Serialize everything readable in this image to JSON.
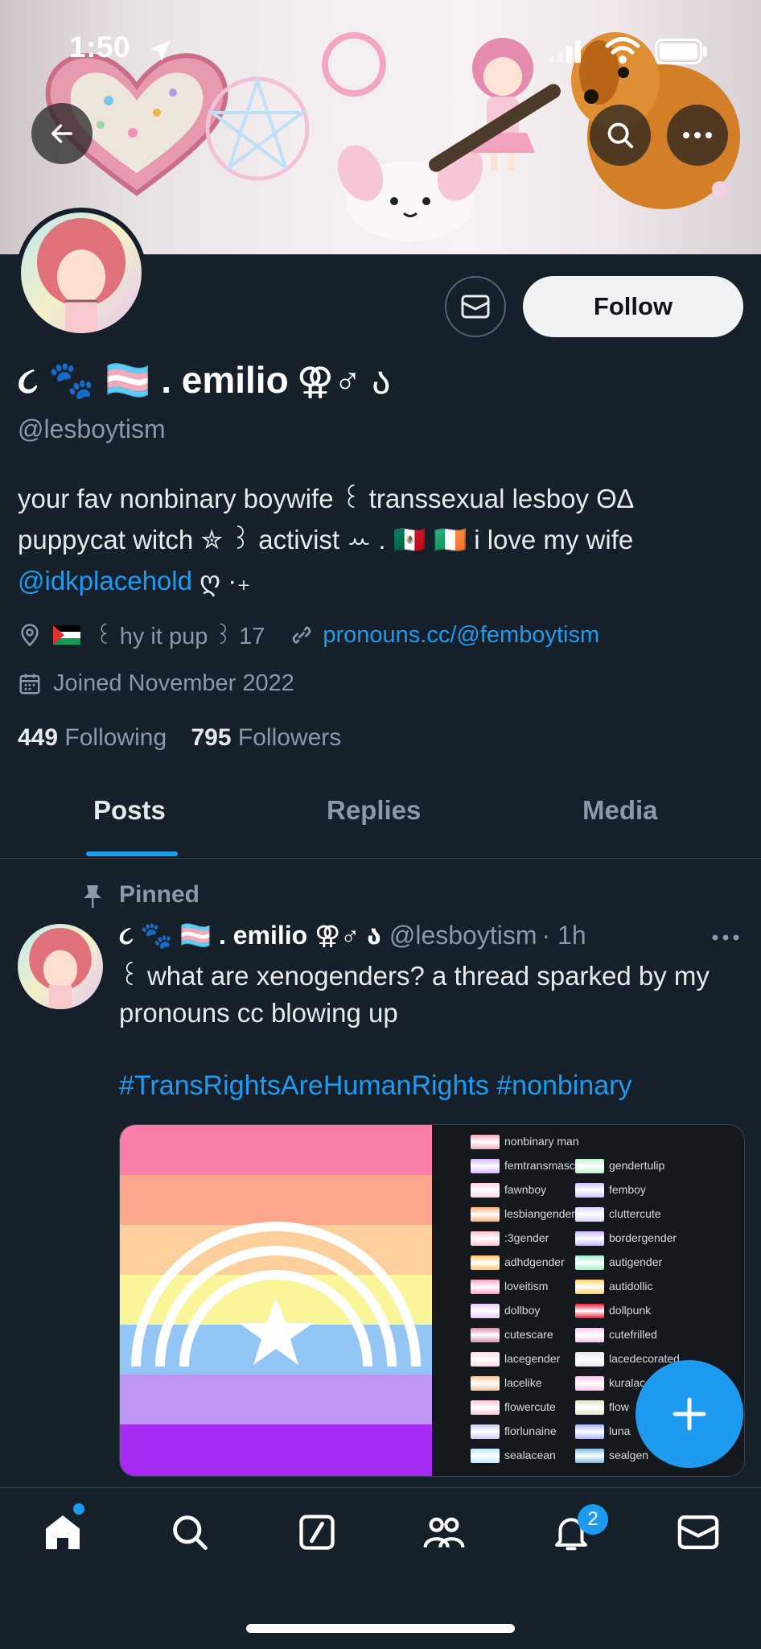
{
  "status_bar": {
    "time": "1:50"
  },
  "profile": {
    "display_name_prefix": "૮ 🐾 🏳️‍⚧️ . emilio",
    "display_name_suffix": "⚢♂ ა",
    "handle": "@lesboytism",
    "follow_label": "Follow",
    "bio_line1": "your fav nonbinary boywife ꒰ transsexual lesboy ΘΔ",
    "bio_line2": "puppycat witch ✮ ꒱ activist ꕀ . 🇲🇽 🇮🇪 i love my wife",
    "bio_mention": "@idkplacehold",
    "bio_tail": "ღ ·₊",
    "location": "꒰ hy it pup ꒱ 17",
    "website": "pronouns.cc/@femboytism",
    "joined": "Joined November 2022",
    "following_count": "449",
    "following_label": "Following",
    "followers_count": "795",
    "followers_label": "Followers"
  },
  "tabs": [
    {
      "label": "Posts",
      "active": true
    },
    {
      "label": "Replies",
      "active": false
    },
    {
      "label": "Media",
      "active": false
    }
  ],
  "post": {
    "pinned_label": "Pinned",
    "author_name": "૮ 🐾 🏳️‍⚧️ . emilio ⚢♂ ა",
    "author_handle": "@lesboytism",
    "time": "· 1h",
    "text": "꒰ what are xenogenders? a thread sparked by my pronouns cc blowing up",
    "hashtags": "#TransRightsAreHumanRights #nonbinary",
    "flag_list": [
      [
        "nonbinary man",
        ""
      ],
      [
        "femtransmasc",
        "gendertulip"
      ],
      [
        "fawnboy",
        "femboy"
      ],
      [
        "lesbiangender",
        "cluttercute"
      ],
      [
        ":3gender",
        "bordergender"
      ],
      [
        "adhdgender",
        "autigender"
      ],
      [
        "loveitism",
        "autidollic"
      ],
      [
        "dollboy",
        "dollpunk"
      ],
      [
        "cutescare",
        "cutefrilled"
      ],
      [
        "lacegender",
        "lacedecorated"
      ],
      [
        "lacelike",
        "kuralace"
      ],
      [
        "flowercute",
        "flow"
      ],
      [
        "florlunaine",
        "luna"
      ],
      [
        "sealacean",
        "sealgen"
      ]
    ]
  },
  "nav": {
    "notifications_badge": "2"
  },
  "colors": {
    "background": "#15202b",
    "accent": "#1d9bf0",
    "muted": "#8b98a5"
  }
}
